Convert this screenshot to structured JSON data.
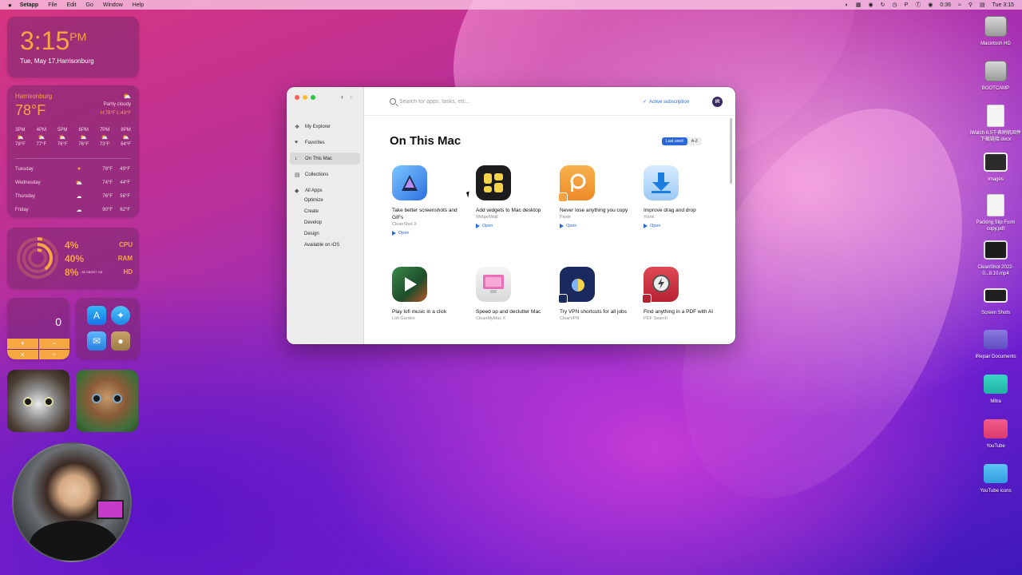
{
  "menubar": {
    "apple": "",
    "items": [
      "Setapp",
      "File",
      "Edit",
      "Go",
      "Window",
      "Help"
    ],
    "clock": "Tue 3:15",
    "timer": "0:36"
  },
  "widgets": {
    "clock": {
      "time": "3:15",
      "ampm": "PM",
      "date": "Tue, May 17,Harrisonburg"
    },
    "weather": {
      "city": "Harrisonburg",
      "temp": "78°F",
      "condition": "Partly cloudy",
      "hilo": "H:78°F L:49°F",
      "hours": [
        {
          "t": "3PM",
          "v": "78°F"
        },
        {
          "t": "4PM",
          "v": "77°F"
        },
        {
          "t": "5PM",
          "v": "76°F"
        },
        {
          "t": "6PM",
          "v": "76°F"
        },
        {
          "t": "7PM",
          "v": "73°F"
        },
        {
          "t": "8PM",
          "v": "64°F"
        }
      ],
      "days": [
        {
          "d": "Tuesday",
          "hi": "78°F",
          "lo": "49°F"
        },
        {
          "d": "Wednesday",
          "hi": "74°F",
          "lo": "44°F"
        },
        {
          "d": "Thursday",
          "hi": "76°F",
          "lo": "56°F"
        },
        {
          "d": "Friday",
          "hi": "90°F",
          "lo": "62°F"
        }
      ]
    },
    "stats": {
      "cpu": {
        "value": "4%",
        "label": "CPU"
      },
      "ram": {
        "value": "40%",
        "label": "RAM"
      },
      "hd": {
        "value": "8%",
        "label": "HD",
        "sub": "86 GB/937 GB"
      }
    },
    "calculator": {
      "display": "0",
      "keys": [
        "+",
        "−",
        "×",
        "÷"
      ]
    }
  },
  "desktop_icons": [
    {
      "label": "Macintosh HD"
    },
    {
      "label": "BOOTCAMP"
    },
    {
      "label": "iWatch 6.5千表刷机固件下载链接.docx"
    },
    {
      "label": "Images"
    },
    {
      "label": "Packing Slip Form copy.pdf"
    },
    {
      "label": "CleanShot 2022-0...8.10.mp4"
    },
    {
      "label": "Screen Shots"
    },
    {
      "label": "iRepair Documents"
    },
    {
      "label": "Mitra"
    },
    {
      "label": "YouTube"
    },
    {
      "label": "YouTube icons"
    }
  ],
  "setapp": {
    "sidebar": {
      "items": [
        {
          "label": "My Explorer",
          "icon": "leaf-icon"
        },
        {
          "label": "Favorites",
          "icon": "heart-icon"
        },
        {
          "label": "On This Mac",
          "icon": "download-icon"
        },
        {
          "label": "Collections",
          "icon": "folder-icon"
        },
        {
          "label": "All Apps",
          "icon": "diamond-icon"
        }
      ],
      "subitems": [
        "Optimize",
        "Create",
        "Develop",
        "Design",
        "Available on iOS"
      ]
    },
    "search": {
      "placeholder": "Search for apps, tasks, etc..."
    },
    "subscription": "Active subscription",
    "avatar": "iR",
    "page_title": "On This Mac",
    "sort": {
      "options": [
        "Last used",
        "A-Z"
      ],
      "selected": "Last used"
    },
    "open_label": "Open",
    "apps": [
      {
        "title": "Take better screenshots and GIFs",
        "name": "CleanShot X",
        "color": "#2f7be6"
      },
      {
        "title": "Add widgets to Mac desktop",
        "name": "WidgetWall",
        "color": "#1c1c1c"
      },
      {
        "title": "Never lose anything you copy",
        "name": "Paste",
        "color": "#f2a341"
      },
      {
        "title": "Improve drag and drop",
        "name": "Yoink",
        "color": "#3b8ee8"
      },
      {
        "title": "Play lofi music in a click",
        "name": "Lofi Garden",
        "color": "#2c6a3a"
      },
      {
        "title": "Speed up and declutter Mac",
        "name": "CleanMyMac X",
        "color": "#e86fb7"
      },
      {
        "title": "Try VPN shortcuts for all jobs",
        "name": "ClearVPN",
        "color": "#1a2a5e"
      },
      {
        "title": "Find anything in a PDF with AI",
        "name": "PDF Search",
        "color": "#c92b3b"
      }
    ]
  }
}
